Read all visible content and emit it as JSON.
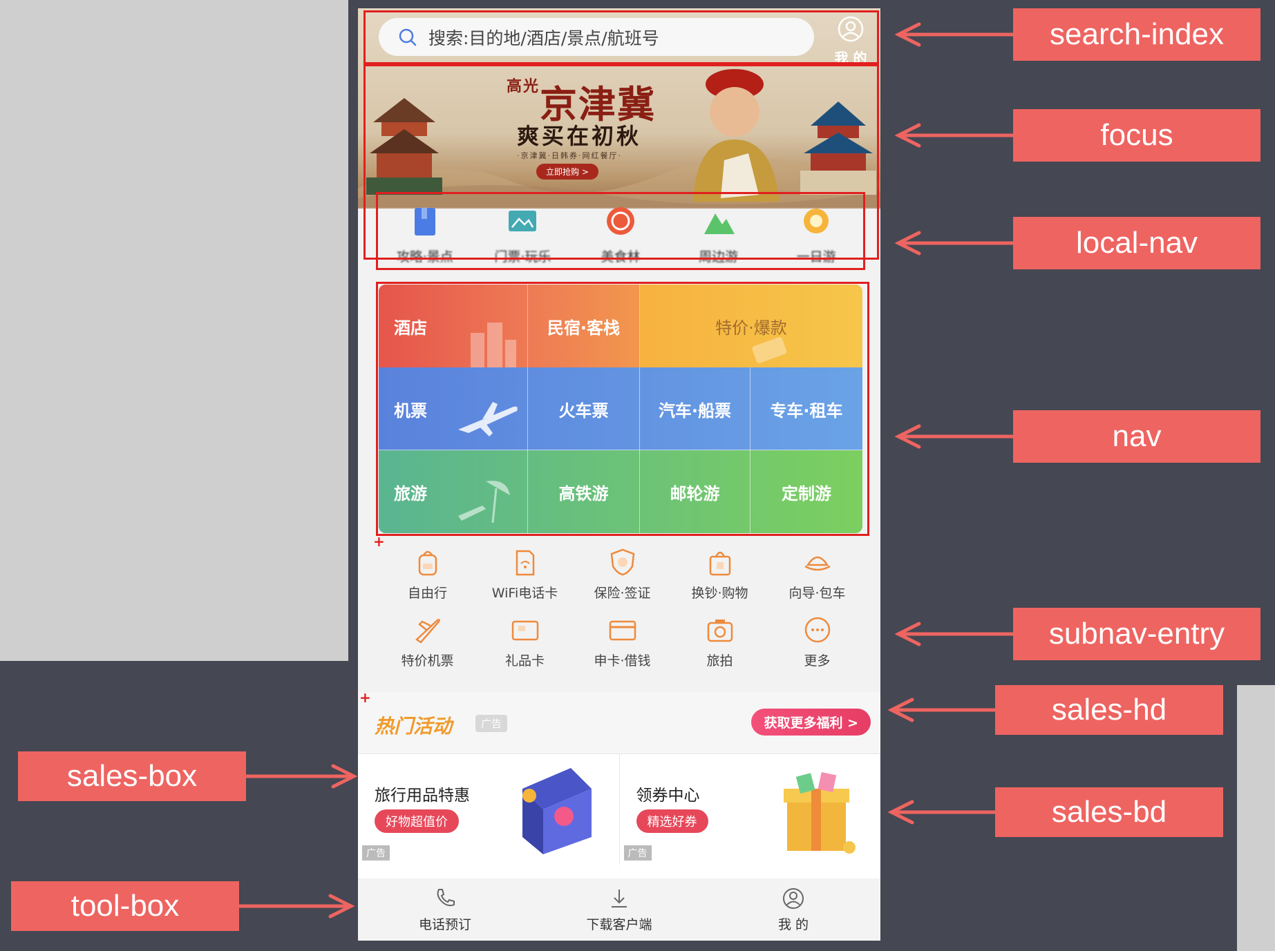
{
  "search": {
    "placeholder": "搜索:目的地/酒店/景点/航班号"
  },
  "user_top": {
    "label": "我 的"
  },
  "banner": {
    "title_main": "京津冀",
    "title_prefix": "高光",
    "subtitle": "爽买在初秋",
    "tagline": "·京津冀·日韩券·网红餐厅·",
    "button": "立即抢购 >"
  },
  "local_nav": [
    {
      "label": "攻略·景点",
      "icon": "guide-icon"
    },
    {
      "label": "门票·玩乐",
      "icon": "ticket-icon"
    },
    {
      "label": "美食林",
      "icon": "food-icon"
    },
    {
      "label": "周边游",
      "icon": "mountain-icon"
    },
    {
      "label": "一日游",
      "icon": "sun-icon"
    }
  ],
  "nav": {
    "row1": [
      "酒店",
      "民宿·客栈",
      "特价·爆款"
    ],
    "row2": [
      "机票",
      "火车票",
      "汽车·船票",
      "专车·租车"
    ],
    "row3": [
      "旅游",
      "高铁游",
      "邮轮游",
      "定制游"
    ]
  },
  "subnav": {
    "row1": [
      {
        "label": "自由行",
        "icon": "backpack-icon"
      },
      {
        "label": "WiFi电话卡",
        "icon": "wifi-card-icon"
      },
      {
        "label": "保险·签证",
        "icon": "shield-icon"
      },
      {
        "label": "换钞·购物",
        "icon": "shopping-bag-icon"
      },
      {
        "label": "向导·包车",
        "icon": "guide-hat-icon"
      }
    ],
    "row2": [
      {
        "label": "特价机票",
        "icon": "plane-icon"
      },
      {
        "label": "礼品卡",
        "icon": "gift-card-icon"
      },
      {
        "label": "申卡·借钱",
        "icon": "credit-card-icon"
      },
      {
        "label": "旅拍",
        "icon": "camera-icon"
      },
      {
        "label": "更多",
        "icon": "more-icon"
      }
    ]
  },
  "sales_hd": {
    "title": "热门活动",
    "ad_tag": "广告",
    "more_button": "获取更多福利 >"
  },
  "sales_bd": [
    {
      "title": "旅行用品特惠",
      "pill": "好物超值价",
      "ad": "广告",
      "image": "suitcase-illustration"
    },
    {
      "title": "领券中心",
      "pill": "精选好券",
      "ad": "广告",
      "image": "gift-box-illustration"
    }
  ],
  "tool_box": [
    {
      "label": "电话预订",
      "icon": "phone-icon"
    },
    {
      "label": "下载客户端",
      "icon": "download-icon"
    },
    {
      "label": "我 的",
      "icon": "user-icon"
    }
  ],
  "annotations": {
    "search_index": "search-index",
    "focus": "focus",
    "local_nav": "local-nav",
    "nav": "nav",
    "subnav_entry": "subnav-entry",
    "sales_hd": "sales-hd",
    "sales_box": "sales-box",
    "sales_bd": "sales-bd",
    "tool_box": "tool-box"
  },
  "colors": {
    "background": "#454752",
    "label_bg": "#ee6461",
    "box_red": "#e11f1f",
    "hotel_red": "#e5554b",
    "flight_blue": "#5a82dc",
    "travel_green": "#5ab591"
  }
}
